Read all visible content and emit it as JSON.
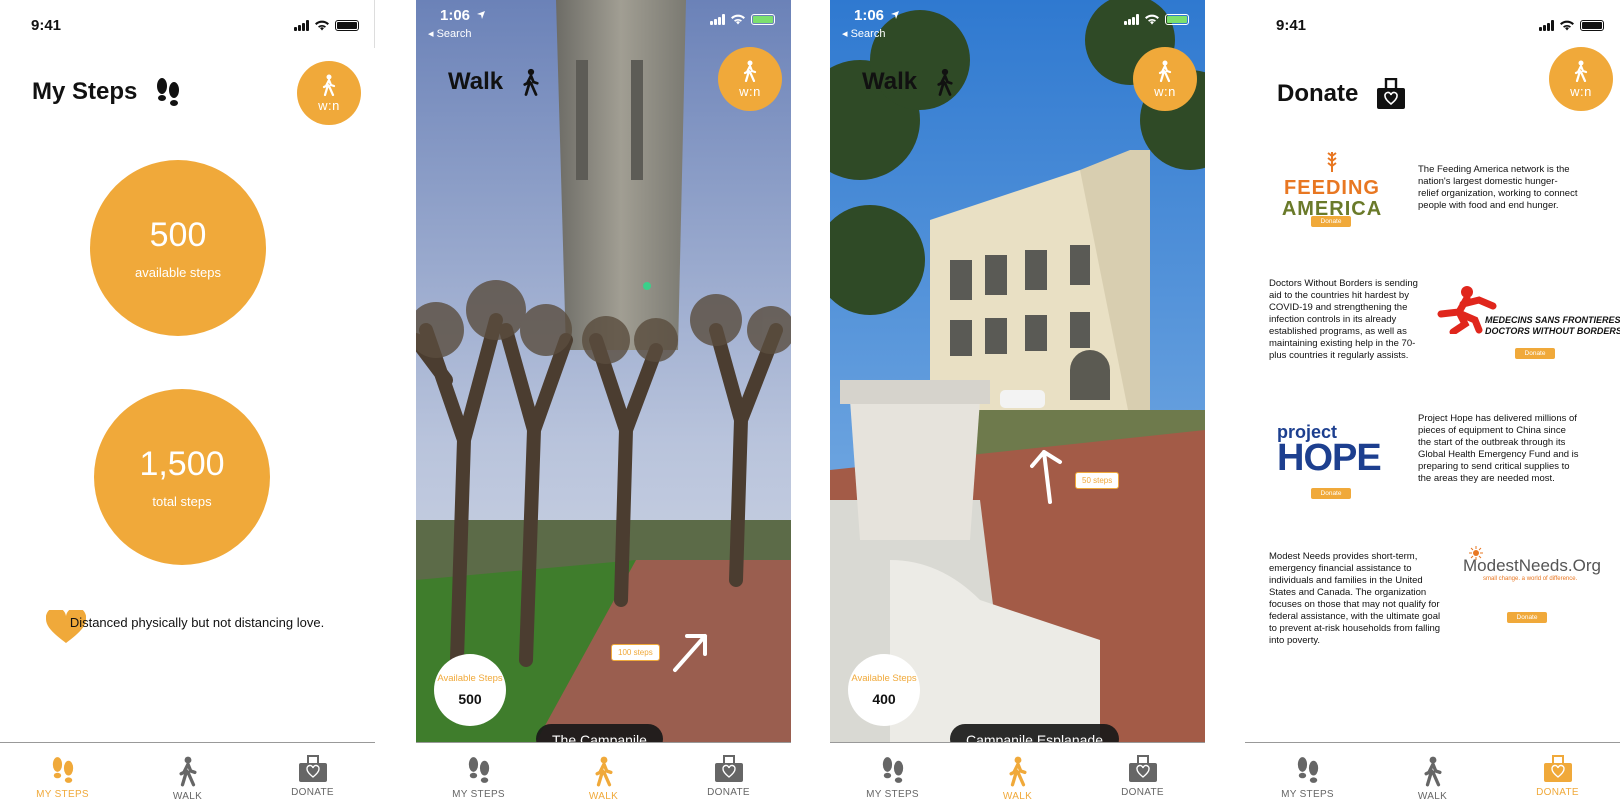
{
  "brand": {
    "accent": "#F0A93A",
    "badge_text": "w:n"
  },
  "screens": {
    "my_steps": {
      "time": "9:41",
      "title": "My Steps",
      "available_value": "500",
      "available_label": "available steps",
      "total_value": "1,500",
      "total_label": "total steps",
      "love_message": "Distanced physically but not distancing love."
    },
    "walk1": {
      "time": "1:06",
      "back": "◂ Search",
      "title": "Walk",
      "available_label": "Available Steps",
      "available_value": "500",
      "steps_tag": "100 steps",
      "place": "The Campanile"
    },
    "walk2": {
      "time": "1:06",
      "back": "◂ Search",
      "title": "Walk",
      "available_label": "Available Steps",
      "available_value": "400",
      "steps_tag": "50 steps",
      "place": "Campanile Esplanade"
    },
    "donate": {
      "time": "9:41",
      "title": "Donate",
      "donate_button": "Donate",
      "orgs": [
        {
          "logo_line1": "FEEDING",
          "logo_line2": "AMERICA",
          "text": "The Feeding America network is the nation's largest domestic hunger-relief organization, working to connect people with food and end hunger."
        },
        {
          "logo_line1": "MEDECINS SANS FRONTIERES",
          "logo_line2": "DOCTORS WITHOUT BORDERS",
          "text": "Doctors Without Borders is sending aid to the countries hit hardest by COVID-19 and strengthening the infection controls in its already established programs, as well as maintaining existing help in the 70-plus countries it regularly assists."
        },
        {
          "logo_line1": "project",
          "logo_line2": "HOPE",
          "text": "Project Hope has delivered millions of pieces of equipment to China since the start of the outbreak through its Global Health Emergency Fund and is preparing to send critical supplies to the areas they are needed most."
        },
        {
          "logo_line1": "ModestNeeds.Org",
          "logo_line2": "small change. a world of difference.",
          "text": "Modest Needs provides short-term, emergency financial assistance to individuals and families in the United States and Canada. The organization focuses on those that may not qualify for federal assistance, with the ultimate goal to prevent at-risk households from falling into poverty."
        }
      ]
    }
  },
  "tabs": {
    "my_steps": "MY STEPS",
    "walk": "WALK",
    "donate": "DONATE"
  },
  "icons": [
    "footprints-icon",
    "walker-icon",
    "donation-box-icon",
    "heart-icon",
    "arrow-icon",
    "signal-icon",
    "wifi-icon",
    "battery-icon",
    "location-arrow-icon"
  ]
}
